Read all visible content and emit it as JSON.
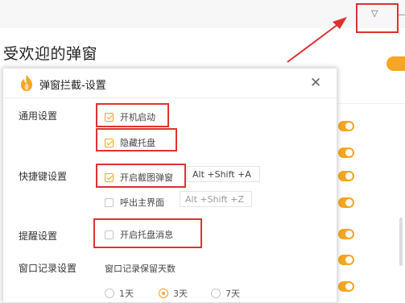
{
  "background": {
    "title": "受欢迎的弹窗",
    "dropdown_glyph": "▽"
  },
  "dialog": {
    "title": "弹窗拦截-设置",
    "close_glyph": "✕",
    "sections": {
      "general": {
        "label": "通用设置",
        "startup": {
          "label": "开机启动",
          "checked": true
        },
        "hide_tray": {
          "label": "隐藏托盘",
          "checked": true
        }
      },
      "hotkeys": {
        "label": "快捷键设置",
        "screenshot_popup": {
          "label": "开启截图弹窗",
          "checked": true,
          "hotkey": "Alt +Shift +A"
        },
        "main_window": {
          "label": "呼出主界面",
          "checked": false,
          "hotkey": "Alt +Shift +Z"
        }
      },
      "reminder": {
        "label": "提醒设置",
        "tray_message": {
          "label": "开启托盘消息",
          "checked": false
        }
      },
      "window_log": {
        "label": "窗口记录设置",
        "retention_label": "窗口记录保留天数",
        "options": [
          "1天",
          "3天",
          "7天"
        ],
        "selected": "3天"
      }
    }
  },
  "colors": {
    "accent": "#f5a623",
    "highlight": "#e03131"
  }
}
